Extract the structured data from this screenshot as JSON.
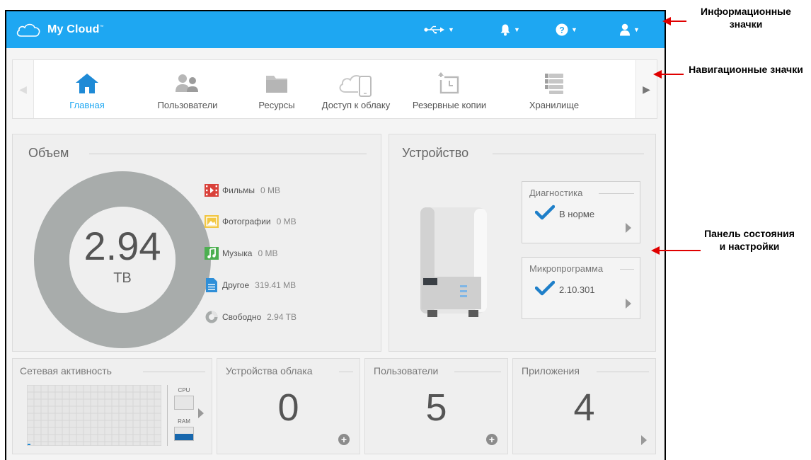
{
  "header": {
    "app_title": "My Cloud",
    "app_title_tm": "™",
    "icons": [
      "usb-icon",
      "bell-icon",
      "help-icon",
      "user-icon"
    ],
    "bg_color": "#1ea7f2"
  },
  "nav": {
    "items": [
      {
        "label": "Главная",
        "icon": "home-icon",
        "active": true
      },
      {
        "label": "Пользователи",
        "icon": "users-icon"
      },
      {
        "label": "Ресурсы",
        "icon": "folder-icon"
      },
      {
        "label": "Доступ к облаку",
        "icon": "cloud-device-icon"
      },
      {
        "label": "Резервные копии",
        "icon": "backup-icon"
      },
      {
        "label": "Хранилище",
        "icon": "storage-icon"
      }
    ]
  },
  "volume": {
    "title": "Объем",
    "total_value": "2.94",
    "total_unit": "TB",
    "legend": [
      {
        "label": "Фильмы",
        "value": "0 MB",
        "icon": "film-icon",
        "color": "#d9413a"
      },
      {
        "label": "Фотографии",
        "value": "0 MB",
        "icon": "photo-icon",
        "color": "#f2c744"
      },
      {
        "label": "Музыка",
        "value": "0 MB",
        "icon": "music-icon",
        "color": "#4caf50"
      },
      {
        "label": "Другое",
        "value": "319.41 MB",
        "icon": "document-icon",
        "color": "#2f8fd8"
      },
      {
        "label": "Свободно",
        "value": "2.94 TB",
        "icon": "pie-icon",
        "color": "#a7abaa"
      }
    ],
    "donut_color": "#a8acab"
  },
  "device": {
    "title": "Устройство",
    "diagnostics": {
      "title": "Диагностика",
      "value": "В норме"
    },
    "firmware": {
      "title": "Микропрограмма",
      "value": "2.10.301"
    }
  },
  "network": {
    "title": "Сетевая активность",
    "cpu_label": "CPU",
    "ram_label": "RAM",
    "ram_level": 0.5
  },
  "cloud_devices": {
    "title": "Устройства облака",
    "count": "0"
  },
  "users_tile": {
    "title": "Пользователи",
    "count": "5"
  },
  "apps_tile": {
    "title": "Приложения",
    "count": "4"
  },
  "annotations": {
    "info_icons": "Информационные значки",
    "nav_icons": "Навигационные значки",
    "status_panel": "Панель состояния и настройки"
  }
}
